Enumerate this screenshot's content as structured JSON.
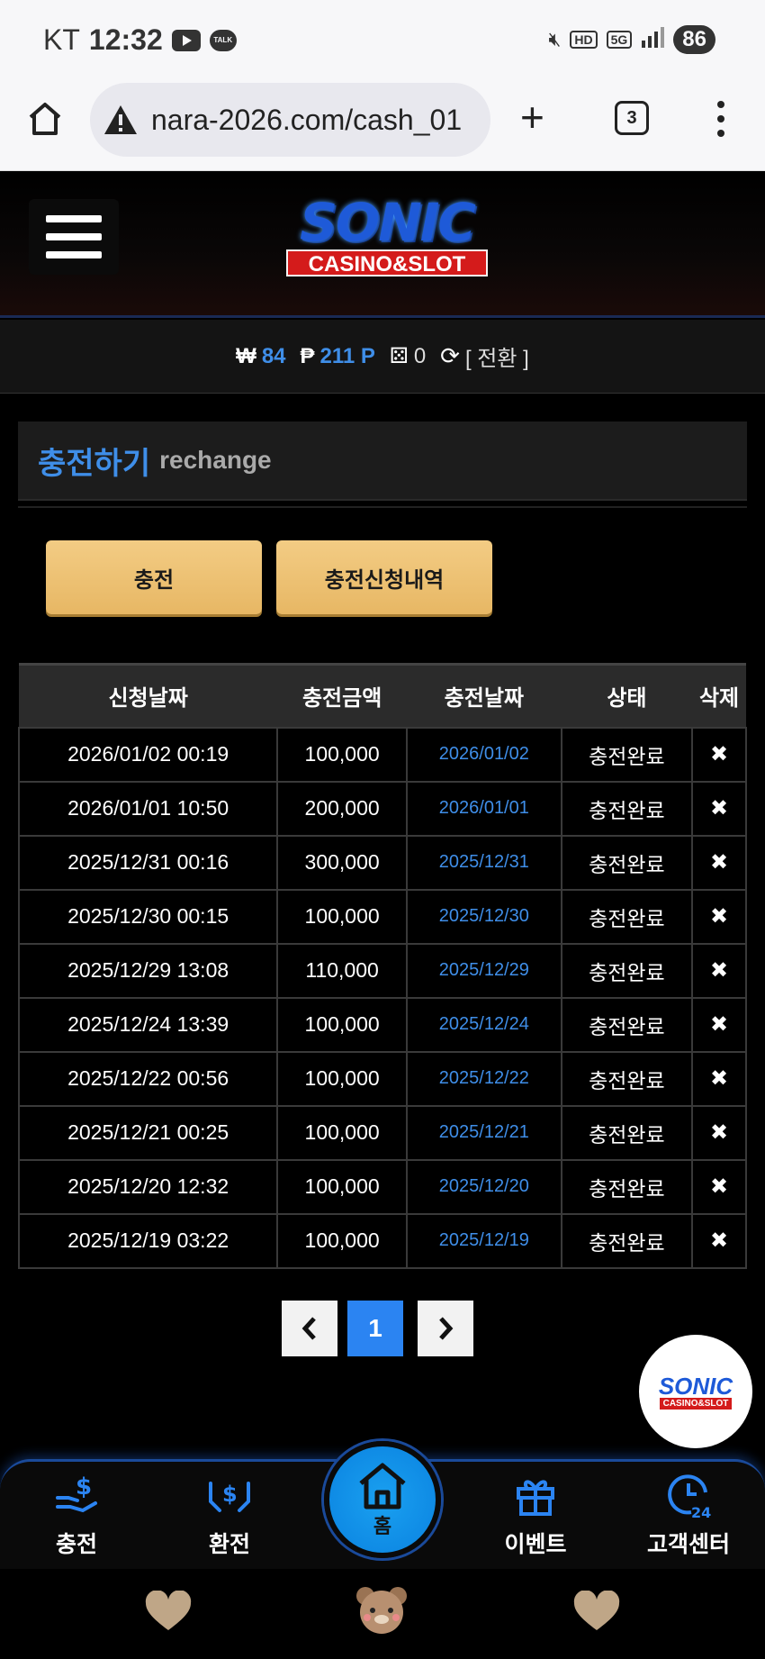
{
  "status_bar": {
    "carrier": "KT",
    "time": "12:32",
    "talk_icon_text": "TALK",
    "hd_label": "HD",
    "network": "5G",
    "battery": "86"
  },
  "browser": {
    "url": "nara-2026.com/cash_01",
    "tab_count": "3"
  },
  "header": {
    "logo_top": "SONIC",
    "logo_bottom": "CASINO&SLOT"
  },
  "balance": {
    "won_symbol": "₩",
    "won_value": "84",
    "point_symbol": "₱",
    "point_value": "211 P",
    "chip_value": "0",
    "switch_label": "[ 전환 ]"
  },
  "section": {
    "title_ko": "충전하기",
    "title_en": "rechange"
  },
  "buttons": {
    "charge": "충전",
    "history": "충전신청내역"
  },
  "table": {
    "headers": [
      "신청날짜",
      "충전금액",
      "충전날짜",
      "상태",
      "삭제"
    ],
    "rows": [
      [
        "2026/01/02 00:19",
        "100,000",
        "2026/01/02",
        "충전완료",
        "✖"
      ],
      [
        "2026/01/01 10:50",
        "200,000",
        "2026/01/01",
        "충전완료",
        "✖"
      ],
      [
        "2025/12/31 00:16",
        "300,000",
        "2025/12/31",
        "충전완료",
        "✖"
      ],
      [
        "2025/12/30 00:15",
        "100,000",
        "2025/12/30",
        "충전완료",
        "✖"
      ],
      [
        "2025/12/29 13:08",
        "110,000",
        "2025/12/29",
        "충전완료",
        "✖"
      ],
      [
        "2025/12/24 13:39",
        "100,000",
        "2025/12/24",
        "충전완료",
        "✖"
      ],
      [
        "2025/12/22 00:56",
        "100,000",
        "2025/12/22",
        "충전완료",
        "✖"
      ],
      [
        "2025/12/21 00:25",
        "100,000",
        "2025/12/21",
        "충전완료",
        "✖"
      ],
      [
        "2025/12/20 12:32",
        "100,000",
        "2025/12/20",
        "충전완료",
        "✖"
      ],
      [
        "2025/12/19 03:22",
        "100,000",
        "2025/12/19",
        "충전완료",
        "✖"
      ]
    ]
  },
  "pagination": {
    "prev": "‹",
    "current": "1",
    "next": "›"
  },
  "float_logo": {
    "top": "SONIC",
    "bottom": "CASINO&SLOT"
  },
  "nav": {
    "charge": "충전",
    "exchange": "환전",
    "home": "홈",
    "event": "이벤트",
    "support": "고객센터"
  },
  "colors": {
    "accent_blue": "#3f8ee8",
    "gold_button": "#e7b764",
    "brand_red": "#d41b1b"
  }
}
